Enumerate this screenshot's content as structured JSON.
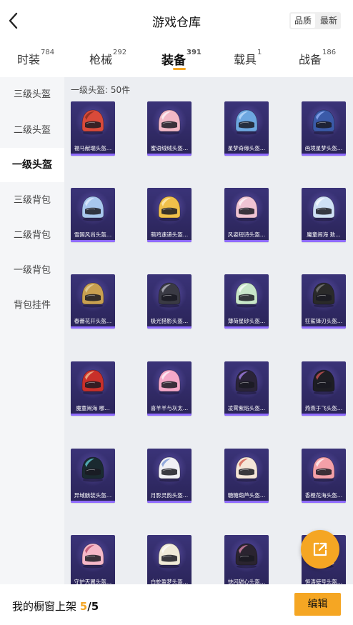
{
  "header": {
    "title": "游戏仓库",
    "sort": {
      "option1": "品质",
      "option2": "最新"
    }
  },
  "tabs": [
    {
      "label": "时装",
      "count": "784"
    },
    {
      "label": "枪械",
      "count": "292"
    },
    {
      "label": "装备",
      "count": "391"
    },
    {
      "label": "载具",
      "count": "1"
    },
    {
      "label": "战备",
      "count": "186"
    }
  ],
  "sidebar": {
    "items": [
      "三级头盔",
      "二级头盔",
      "一级头盔",
      "三级背包",
      "二级背包",
      "一级背包",
      "背包挂件"
    ],
    "active_index": 2
  },
  "section": {
    "label": "一级头盔: 50件"
  },
  "items": [
    {
      "name": "福马献瑞头盔…",
      "color": "#d94a3a",
      "accent": "#7a2a1a"
    },
    {
      "name": "蜜语绒绒头盔…",
      "color": "#f2b8c6",
      "accent": "#ffffff"
    },
    {
      "name": "星梦奇缘头盔…",
      "color": "#6da7e0",
      "accent": "#c6e1ff"
    },
    {
      "name": "画境星梦头盔…",
      "color": "#3a5aa8",
      "accent": "#9ab8ff"
    },
    {
      "name": "雪国风尚头盔…",
      "color": "#a8c7ee",
      "accent": "#e8f2ff"
    },
    {
      "name": "萌鸡速递头盔…",
      "color": "#f0c04a",
      "accent": "#fff2c4"
    },
    {
      "name": "风姿短诗头盔…",
      "color": "#f0c4d4",
      "accent": "#ffffff"
    },
    {
      "name": "魔童闹海 敖…",
      "color": "#cfe0f5",
      "accent": "#ffffff"
    },
    {
      "name": "春蕾花开头盔…",
      "color": "#c8a050",
      "accent": "#e8d8a8"
    },
    {
      "name": "极光猎影头盔…",
      "color": "#3a3a44",
      "accent": "#c9c9d4"
    },
    {
      "name": "薄荷星砂头盔…",
      "color": "#c8e6c9",
      "accent": "#ffffff"
    },
    {
      "name": "狂鲨锋刃头盔…",
      "color": "#2a2a2a",
      "accent": "#888888"
    },
    {
      "name": "魔童闹海 哪…",
      "color": "#c8302a",
      "accent": "#f0d0a0"
    },
    {
      "name": "喜羊羊与灰太…",
      "color": "#f5a8c8",
      "accent": "#ffffff"
    },
    {
      "name": "凌霄紫焰头盔…",
      "color": "#2a2438",
      "accent": "#b48cff"
    },
    {
      "name": "燕燕于飞头盔…",
      "color": "#1e1e24",
      "accent": "#e05a5a"
    },
    {
      "name": "异域骸装头盔…",
      "color": "#1a2a30",
      "accent": "#6ae0e8"
    },
    {
      "name": "月影灵韵头盔…",
      "color": "#f0f0f5",
      "accent": "#6a8ad0"
    },
    {
      "name": "糖糖葫芦头盔…",
      "color": "#f5e6d8",
      "accent": "#d0483a"
    },
    {
      "name": "香橙花海头盔…",
      "color": "#f4a0a8",
      "accent": "#ffffff"
    },
    {
      "name": "守护天翼头盔…",
      "color": "#f5b8c8",
      "accent": "#b03a5a"
    },
    {
      "name": "白蛇盈梦头盔…",
      "color": "#f0ead8",
      "accent": "#ffffff"
    },
    {
      "name": "快闪甜心头盔…",
      "color": "#2a2430",
      "accent": "#f090b8"
    },
    {
      "name": "恒涛使号头盔…",
      "color": "#f0d0dc",
      "accent": "#ffffff"
    }
  ],
  "bottom": {
    "label": "我的橱窗上架",
    "current": "5",
    "total": "/5",
    "edit_label": "编辑"
  }
}
